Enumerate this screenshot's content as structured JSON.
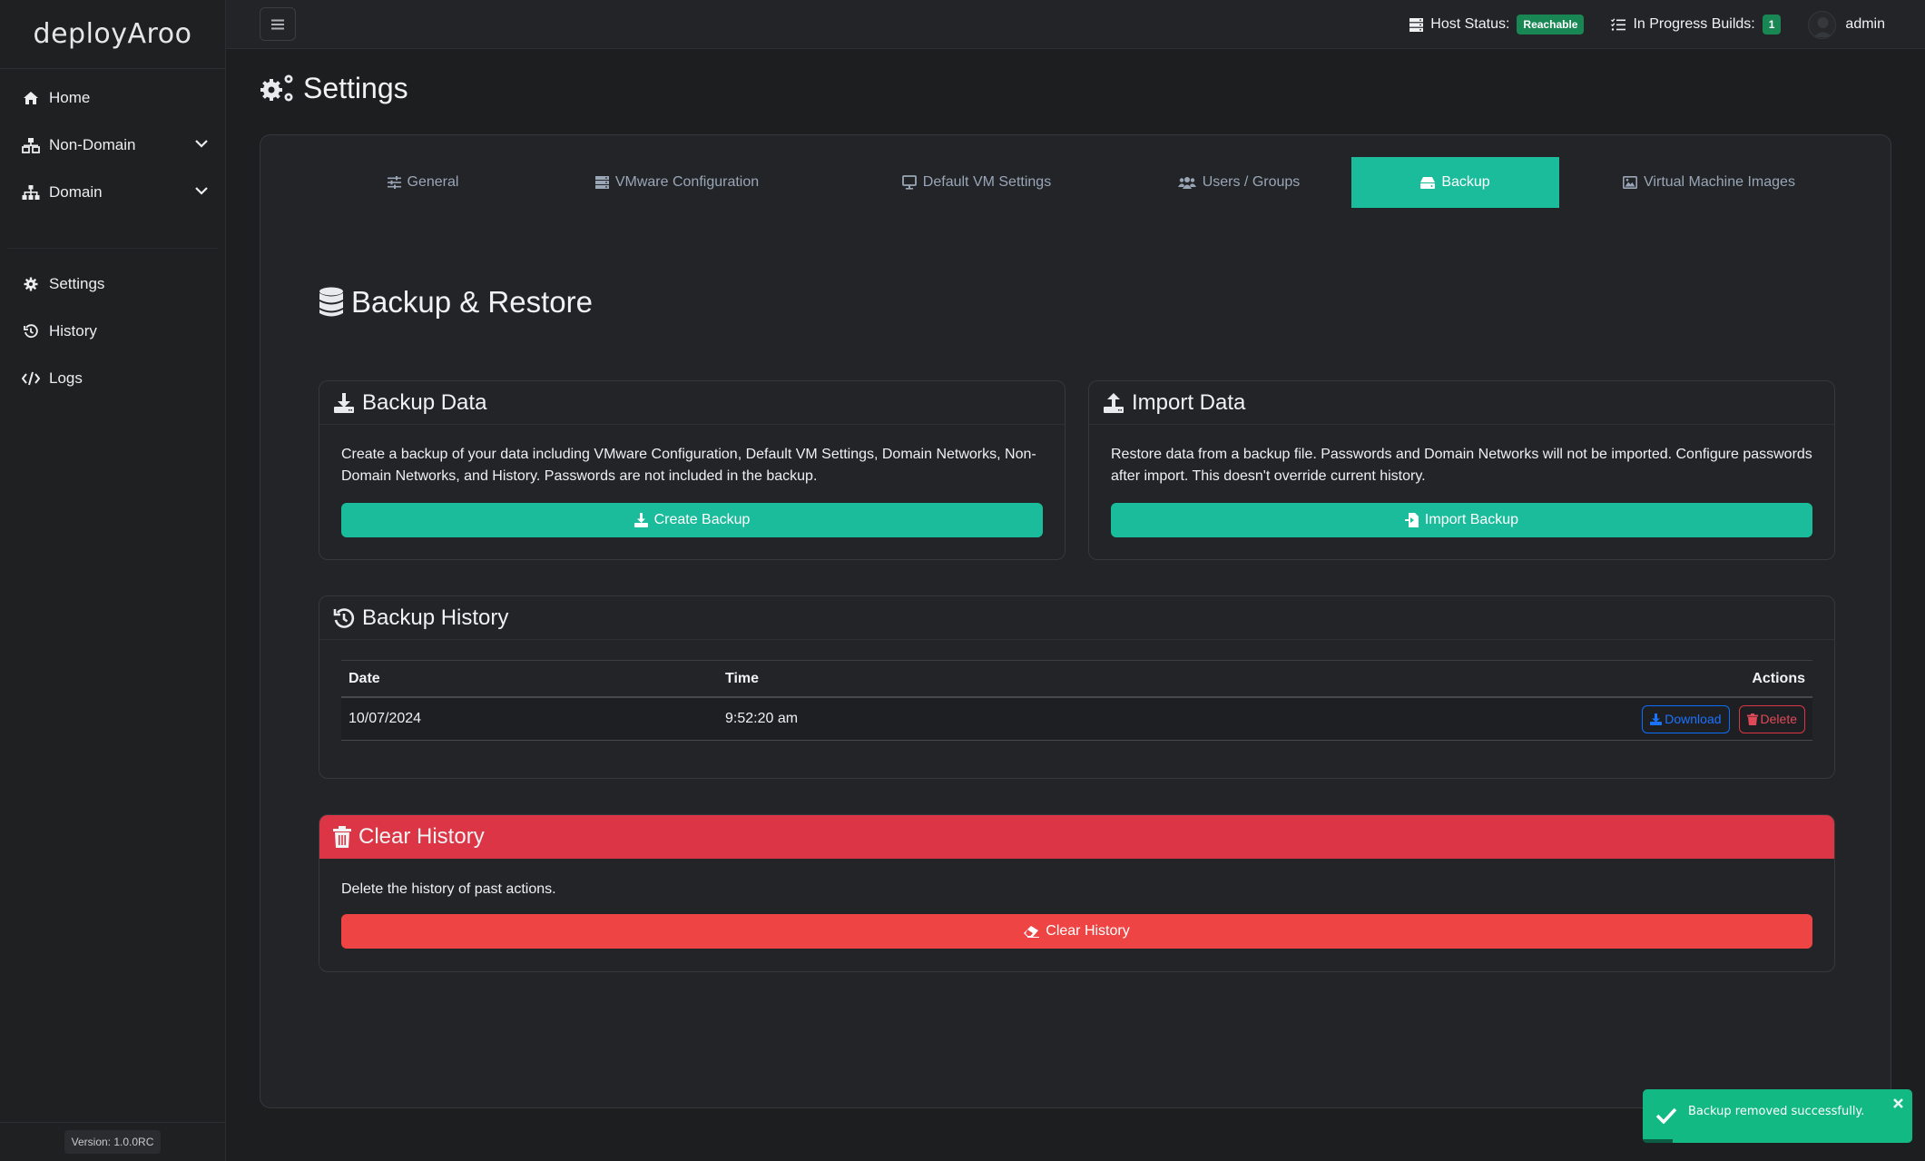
{
  "app": {
    "brand": "deployAroo",
    "version": "Version: 1.0.0RC"
  },
  "sidebar": {
    "items": [
      {
        "label": "Home",
        "icon": "home-icon"
      },
      {
        "label": "Non-Domain",
        "icon": "network-icon",
        "expandable": true
      },
      {
        "label": "Domain",
        "icon": "sitemap-icon",
        "expandable": true
      },
      {
        "label": "Settings",
        "icon": "gear-icon"
      },
      {
        "label": "History",
        "icon": "history-icon"
      },
      {
        "label": "Logs",
        "icon": "code-icon"
      }
    ]
  },
  "header": {
    "host_status_label": "Host Status:",
    "host_status_value": "Reachable",
    "builds_label": "In Progress Builds:",
    "builds_count": "1",
    "user": "admin",
    "status_color": "#198754"
  },
  "page": {
    "title": "Settings"
  },
  "tabs": [
    {
      "label": "General",
      "icon": "sliders-icon",
      "active": false
    },
    {
      "label": "VMware Configuration",
      "icon": "server-icon",
      "active": false
    },
    {
      "label": "Default VM Settings",
      "icon": "desktop-icon",
      "active": false
    },
    {
      "label": "Users / Groups",
      "icon": "users-icon",
      "active": false
    },
    {
      "label": "Backup",
      "icon": "hdd-icon",
      "active": true
    },
    {
      "label": "Virtual Machine Images",
      "icon": "image-icon",
      "active": false
    }
  ],
  "backup": {
    "section_title": "Backup & Restore",
    "backup_card": {
      "title": "Backup Data",
      "description": "Create a backup of your data including VMware Configuration, Default VM Settings, Domain Networks, Non-Domain Networks, and History. Passwords are not included in the backup.",
      "button": "Create Backup"
    },
    "import_card": {
      "title": "Import Data",
      "description": "Restore data from a backup file. Passwords and Domain Networks will not be imported. Configure passwords after import. This doesn't override current history.",
      "button": "Import Backup"
    },
    "history_card": {
      "title": "Backup History",
      "columns": [
        "Date",
        "Time",
        "Actions"
      ],
      "rows": [
        {
          "date": "10/07/2024",
          "time": "9:52:20 am",
          "download_label": "Download",
          "delete_label": "Delete"
        }
      ]
    },
    "clear_card": {
      "title": "Clear History",
      "description": "Delete the history of past actions.",
      "button": "Clear History"
    }
  },
  "toast": {
    "message": "Backup removed successfully.",
    "type": "success",
    "progress_remaining": 0.11
  },
  "colors": {
    "accent": "#1abc9c",
    "danger": "#dc3545",
    "danger_button": "#ef4444",
    "toast_success": "#13b982",
    "link_blue": "#0d6efd"
  }
}
